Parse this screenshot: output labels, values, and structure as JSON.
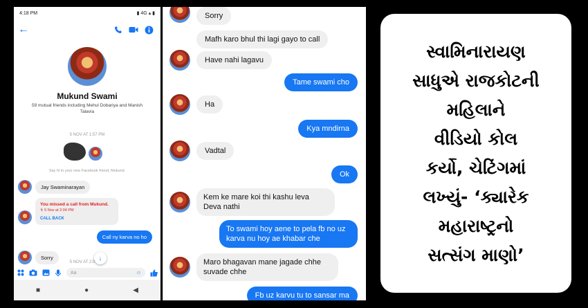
{
  "status": {
    "time": "4:18 PM",
    "right": "▮ 4G ▴ ▮"
  },
  "profile": {
    "name": "Mukund Swami",
    "mutual": "59 mutual friends including Mehul Dobariya and Manish Talavia",
    "timestamp": "5 NOV AT 1:57 PM",
    "hint": "Say hi to your new Facebook friend, Mukund."
  },
  "left_chat": {
    "msg1": "Jay Swaminarayan",
    "missed_title": "You missed a call from Mukund.",
    "missed_time": "5 Nov at 2:04 PM",
    "call_back": "CALL BACK",
    "out1": "Call ny karva no ho",
    "msg2": "Sorry",
    "partial_ts": "5 NOV AT 2:04 PM"
  },
  "composer": {
    "placeholder": "Aa",
    "emoji": "☺"
  },
  "chat": [
    {
      "dir": "in",
      "text": "Sorry"
    },
    {
      "dir": "in",
      "text": "Mafh karo bhul thi lagi gayo to call"
    },
    {
      "dir": "in",
      "text": "Have nahi lagavu"
    },
    {
      "dir": "out",
      "text": "Tame swami cho"
    },
    {
      "dir": "in",
      "text": "Ha"
    },
    {
      "dir": "out",
      "text": "Kya mndirna"
    },
    {
      "dir": "in",
      "text": "Vadtal"
    },
    {
      "dir": "out",
      "text": "Ok"
    },
    {
      "dir": "in",
      "text": "Kem ke mare koi thi kashu leva Deva nathi"
    },
    {
      "dir": "out",
      "text": "To swami hoy aene to pela fb no uz karva nu hoy ae khabar che"
    },
    {
      "dir": "in",
      "text": "Maro bhagavan mane jagade chhe suvade chhe"
    },
    {
      "dir": "out",
      "text": "Fb uz karvu tu to sansar ma"
    }
  ],
  "headline": [
    "સ્વામિનારાયણ",
    "સાધુએ રાજકોટની",
    "મહિલાને",
    "વીડિયો કોલ",
    "કર્યો, ચેટિંગમાં",
    "લખ્યું- ‘ક્યારેક",
    "મહારાષ્ટ્રનો",
    "સત્સંગ માણો’"
  ],
  "colors": {
    "accent": "#1877f2",
    "missed": "#e02020",
    "bubble_in": "#efefef"
  }
}
